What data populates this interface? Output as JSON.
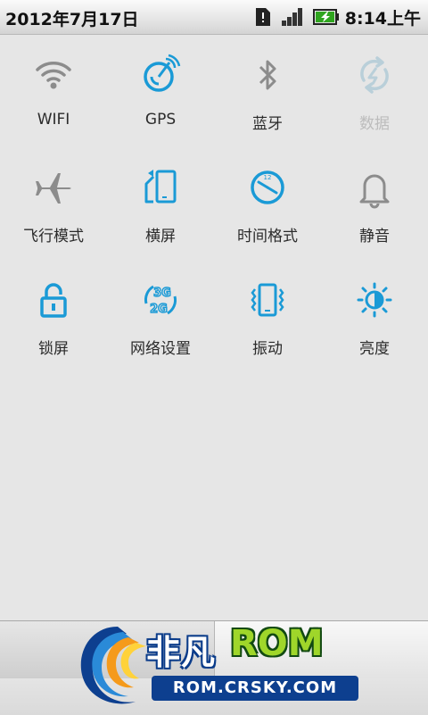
{
  "status_bar": {
    "date": "2012年7月17日",
    "time": "8:14上午",
    "icons": [
      "sd-card-icon",
      "signal-icon",
      "battery-charging-icon"
    ]
  },
  "toggles": [
    {
      "label": "WIFI",
      "icon": "wifi-icon",
      "state": "off"
    },
    {
      "label": "GPS",
      "icon": "gps-icon",
      "state": "on"
    },
    {
      "label": "蓝牙",
      "icon": "bluetooth-icon",
      "state": "off"
    },
    {
      "label": "数据",
      "icon": "data-icon",
      "state": "disabled"
    },
    {
      "label": "飞行模式",
      "icon": "airplane-icon",
      "state": "off"
    },
    {
      "label": "横屏",
      "icon": "rotation-icon",
      "state": "on"
    },
    {
      "label": "时间格式",
      "icon": "clock-icon",
      "state": "on"
    },
    {
      "label": "静音",
      "icon": "bell-icon",
      "state": "off"
    },
    {
      "label": "锁屏",
      "icon": "lock-icon",
      "state": "on"
    },
    {
      "label": "网络设置",
      "icon": "network-3g2g-icon",
      "state": "on"
    },
    {
      "label": "振动",
      "icon": "vibrate-icon",
      "state": "on"
    },
    {
      "label": "亮度",
      "icon": "brightness-icon",
      "state": "on"
    }
  ],
  "logo": {
    "name_cn": "非凡",
    "name_rom": "ROM",
    "url": "ROM.CRSKY.COM"
  },
  "colors": {
    "active": "#1a9ad6",
    "inactive": "#8c8c8c",
    "disabled": "#b9cfd9"
  }
}
